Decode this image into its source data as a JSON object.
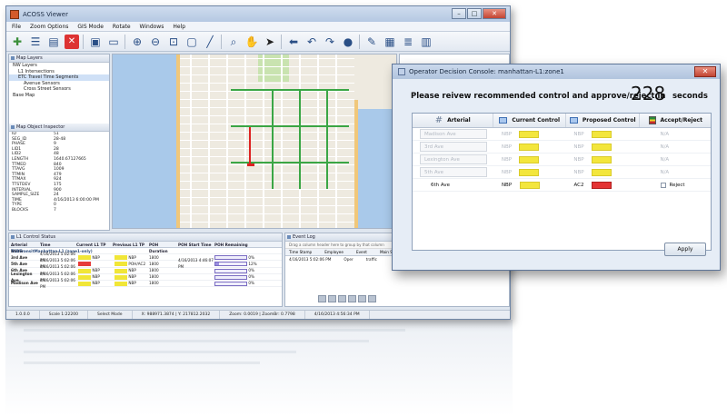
{
  "main_window": {
    "title": "ACOSS Viewer",
    "menu": [
      "File",
      "Zoom Options",
      "GIS Mode",
      "Rotate",
      "Windows",
      "Help"
    ],
    "toolbar_icons": [
      "zoom-in-icon",
      "zoom-out-icon",
      "fit-icon",
      "measure-icon",
      "search-icon",
      "pan-icon",
      "select-icon",
      "back-icon",
      "undo-icon",
      "redo-icon",
      "globe-icon"
    ]
  },
  "layers_panel": {
    "title": "Map Layers",
    "items": [
      "NW Layers",
      "L1 Intersections",
      "ETC Travel Time Segments",
      "Avenue Sensors",
      "Cross Street Sensors",
      "Base Map"
    ]
  },
  "inspector": {
    "title": "Map Object Inspector",
    "fields": [
      {
        "k": "ID",
        "v": "51"
      },
      {
        "k": "SEG_ID",
        "v": "28-48"
      },
      {
        "k": "PHASE",
        "v": "9"
      },
      {
        "k": "LID1",
        "v": "28"
      },
      {
        "k": "LID2",
        "v": "48"
      },
      {
        "k": "LENGTH",
        "v": "1640.67127665"
      },
      {
        "k": "TTMED",
        "v": "840"
      },
      {
        "k": "TTAVG",
        "v": "1009"
      },
      {
        "k": "TTMIN",
        "v": "479"
      },
      {
        "k": "TTMAX",
        "v": "924"
      },
      {
        "k": "TTSTDEV",
        "v": "175"
      },
      {
        "k": "INTERVAL",
        "v": "900"
      },
      {
        "k": "SAMPLE_SIZE",
        "v": "24"
      },
      {
        "k": "TIME",
        "v": "4/16/2013 6:00:00 PM"
      },
      {
        "k": "TYPE",
        "v": "0"
      },
      {
        "k": "BLOCKS",
        "v": "7"
      }
    ]
  },
  "status_panel": {
    "title": "L1 Control Status",
    "headers": [
      "Arterial Name",
      "Time",
      "Current L1 TP",
      "Previous L1 TP",
      "POH Duration",
      "POH Start Time",
      "POH Remaining"
    ],
    "group": "TCDTransitManhattan-L1 (zone1-only)",
    "rows": [
      {
        "art": "3rd Ave",
        "time": "4/16/2013 5:02:06 PM",
        "cur": "NBP",
        "cur_color": "yellow",
        "prev": "NBP",
        "prev_color": "yellow",
        "dur": "1800",
        "start": "",
        "rem": 0,
        "rem_label": "0%"
      },
      {
        "art": "5th Ave",
        "time": "4/16/2013 5:02:06 PM",
        "cur": "",
        "cur_color": "red",
        "prev": "POH/AC2",
        "prev_color": "yellow",
        "dur": "1800",
        "start": "4/16/2013 4:46:07 PM",
        "rem": 0.12,
        "rem_label": "12%"
      },
      {
        "art": "6th Ave",
        "time": "4/16/2013 5:02:06 PM",
        "cur": "NBP",
        "cur_color": "yellow",
        "prev": "NBP",
        "prev_color": "yellow",
        "dur": "1800",
        "start": "",
        "rem": 0,
        "rem_label": "0%"
      },
      {
        "art": "Lexington Ave",
        "time": "4/16/2013 5:02:06 PM",
        "cur": "NBP",
        "cur_color": "yellow",
        "prev": "NBP",
        "prev_color": "yellow",
        "dur": "1800",
        "start": "",
        "rem": 0,
        "rem_label": "0%"
      },
      {
        "art": "Madison Ave",
        "time": "4/16/2013 5:02:06 PM",
        "cur": "NBP",
        "cur_color": "yellow",
        "prev": "NBP",
        "prev_color": "yellow",
        "dur": "1800",
        "start": "",
        "rem": 0,
        "rem_label": "0%"
      }
    ]
  },
  "event_panel": {
    "title": "Event Log",
    "hint": "Drag a column header here to group by that column",
    "headers": [
      "Time Stamp",
      "Employee",
      "Event",
      "Main St"
    ],
    "rows": [
      {
        "ts": "4/16/2013 5:02:06 PM",
        "emp": "Oper",
        "ev": "traffic",
        "main": ""
      }
    ]
  },
  "statusbar": {
    "version": "1.0.0.0",
    "scale": "Scale 1:22200",
    "mode": "Select Mode",
    "coords": "X: 988971.3874 | Y: 217812.2032",
    "zoom": "Zoom: 0.0019 | ZoomBr: 0.7798",
    "time": "4/16/2013 4:56:34 PM"
  },
  "dialog": {
    "title": "Operator Decision Console: manhattan-L1:zone1",
    "prompt": "Please reivew recommended control and approve/reject in",
    "countdown": "228",
    "seconds_label": "seconds",
    "headers": {
      "arterial": "Arterial",
      "current": "Current Control",
      "proposed": "Proposed Control",
      "accept": "Accept/Reject"
    },
    "rows": [
      {
        "arterial": "Madison Ave",
        "current": "NBP",
        "current_color": "yellow",
        "proposed": "NBP",
        "proposed_color": "yellow",
        "accept": "N/A",
        "active": false
      },
      {
        "arterial": "3rd Ave",
        "current": "NBP",
        "current_color": "yellow",
        "proposed": "NBP",
        "proposed_color": "yellow",
        "accept": "N/A",
        "active": false
      },
      {
        "arterial": "Lexington Ave",
        "current": "NBP",
        "current_color": "yellow",
        "proposed": "NBP",
        "proposed_color": "yellow",
        "accept": "N/A",
        "active": false
      },
      {
        "arterial": "5th Ave",
        "current": "NBP",
        "current_color": "yellow",
        "proposed": "NBP",
        "proposed_color": "yellow",
        "accept": "N/A",
        "active": false
      },
      {
        "arterial": "6th Ave",
        "current": "NBP",
        "current_color": "yellow",
        "proposed": "AC2",
        "proposed_color": "red",
        "accept": "Reject",
        "active": true
      }
    ],
    "apply_label": "Apply"
  },
  "colors": {
    "yellow": "#f1e637",
    "red": "#e43333",
    "accent": "#6f86a6"
  }
}
